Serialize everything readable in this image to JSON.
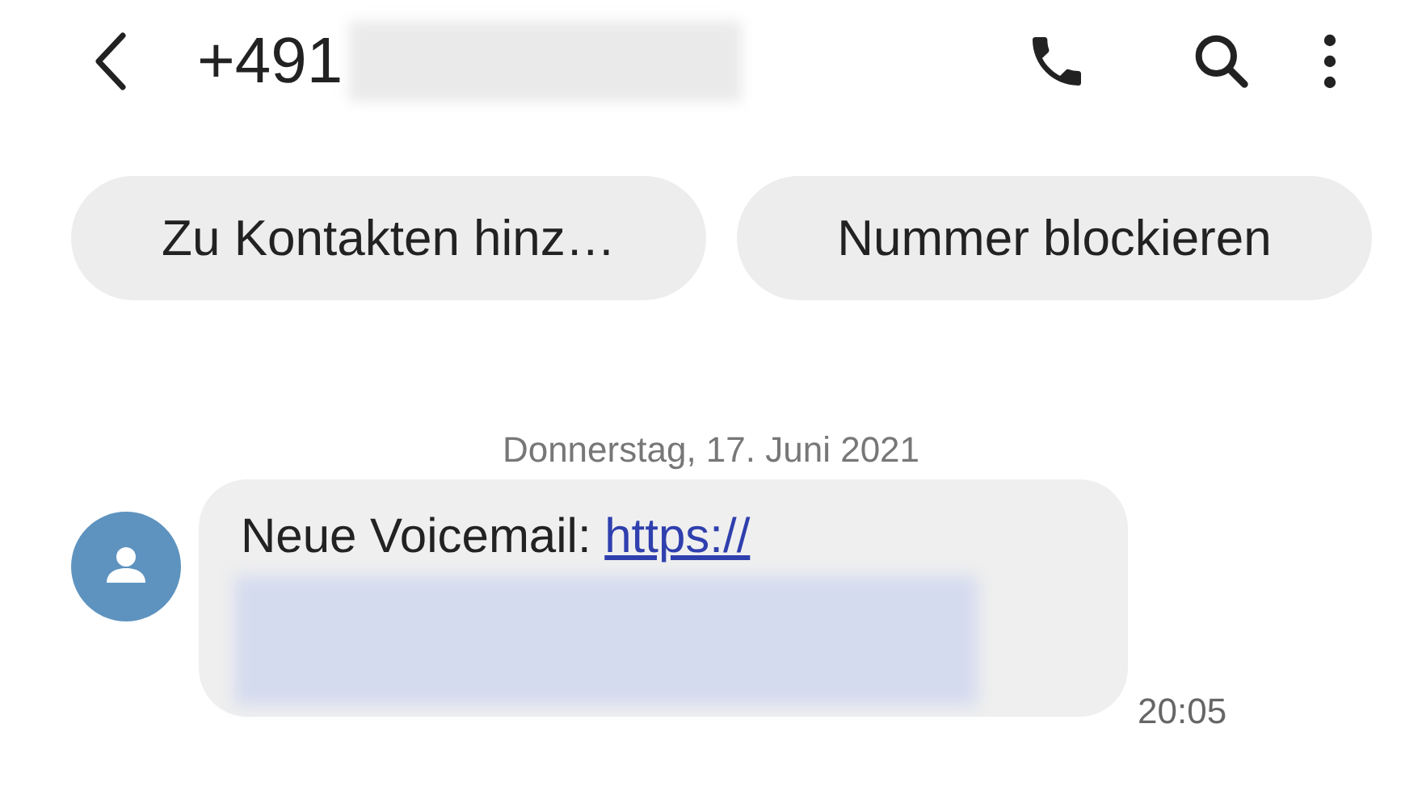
{
  "header": {
    "title": "+491"
  },
  "actions": [
    {
      "label": "Zu Kontakten hinz…"
    },
    {
      "label": "Nummer blockieren"
    }
  ],
  "date": "Donnerstag, 17. Juni 2021",
  "message": {
    "text": "Neue Voicemail:",
    "link": "https://",
    "time": "20:05"
  }
}
